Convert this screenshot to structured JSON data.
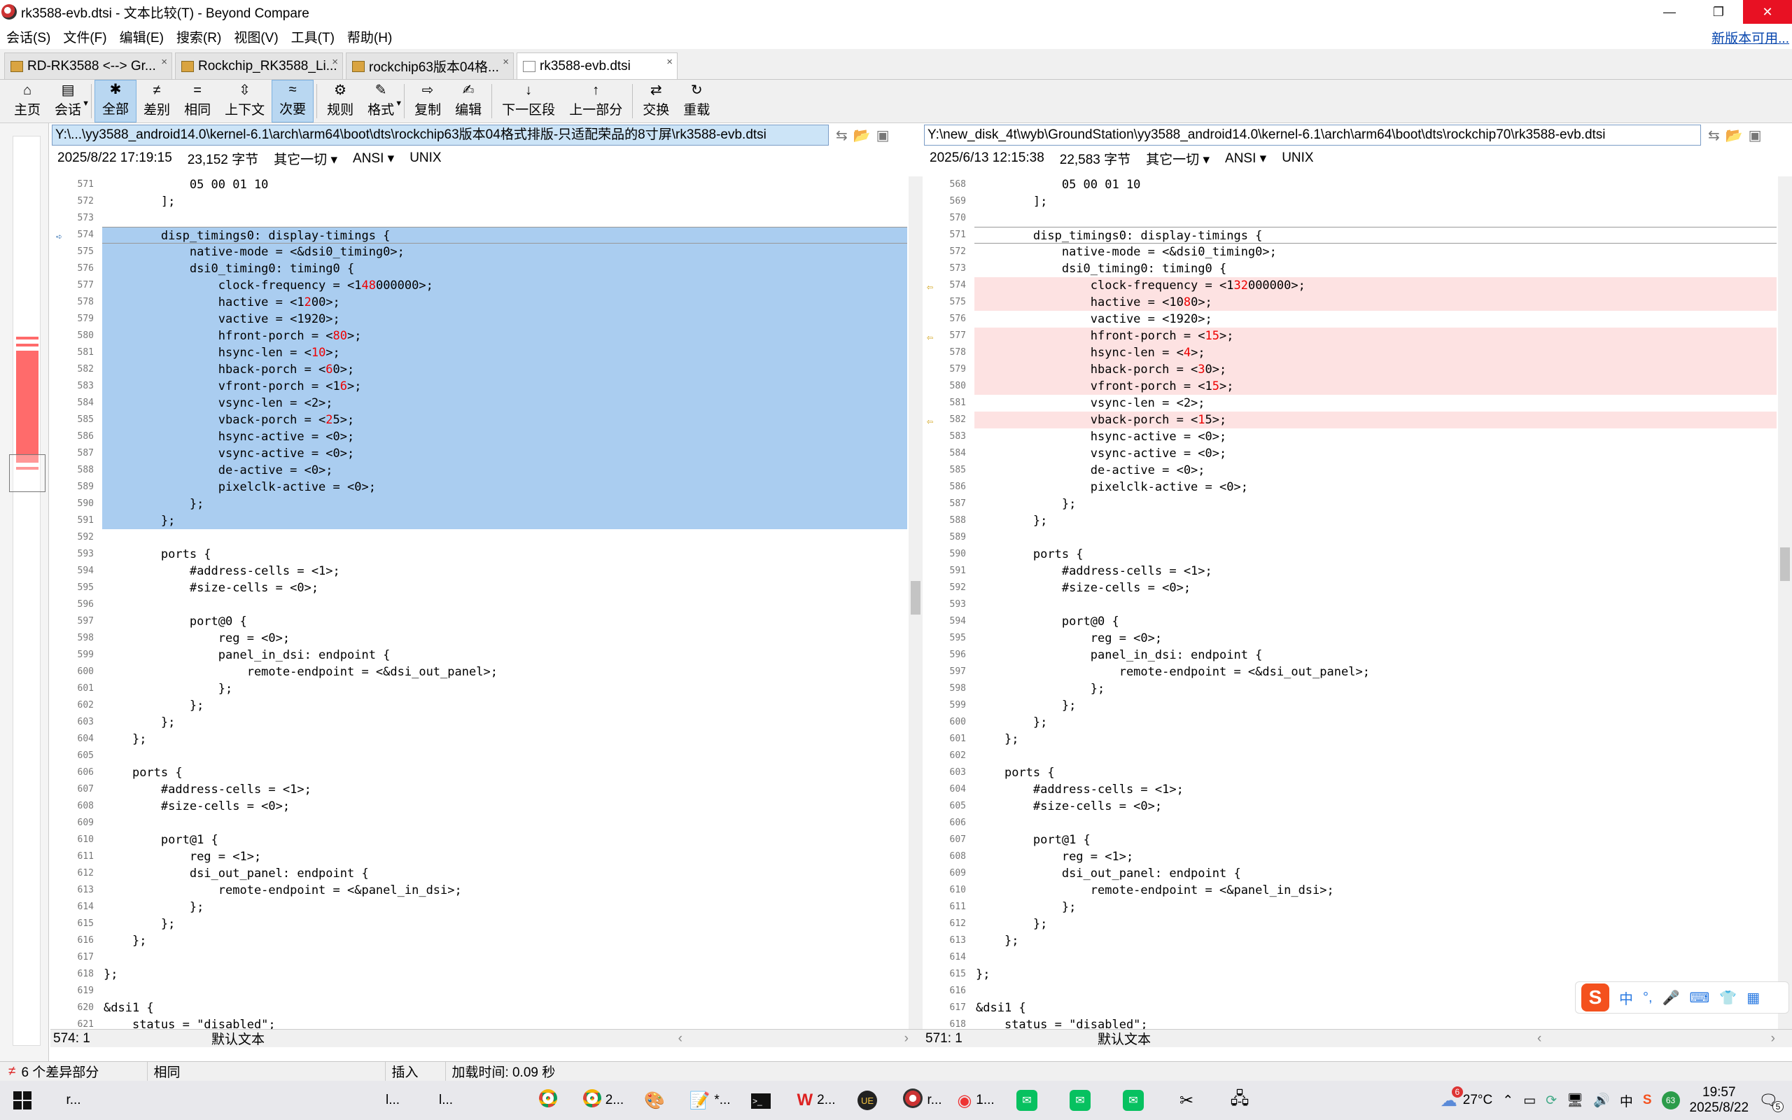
{
  "window": {
    "title": "rk3588-evb.dtsi - 文本比较(T) - Beyond Compare",
    "minimize": "—",
    "maximize": "❐",
    "close": "✕"
  },
  "menu": {
    "items": [
      "会话(S)",
      "文件(F)",
      "编辑(E)",
      "搜索(R)",
      "视图(V)",
      "工具(T)",
      "帮助(H)"
    ],
    "update_link": "新版本可用..."
  },
  "tabs": [
    {
      "label": "RD-RK3588 <--> Gr...",
      "close": "×"
    },
    {
      "label": "Rockchip_RK3588_Li...",
      "close": "×"
    },
    {
      "label": "rockchip63版本04格...",
      "close": "×"
    },
    {
      "label": "rk3588-evb.dtsi",
      "close": "×"
    }
  ],
  "toolbar": [
    {
      "icon": "⌂",
      "label": "主页",
      "name": "home-button"
    },
    {
      "icon": "▤",
      "label": "会话",
      "name": "session-button",
      "drop": true
    },
    {
      "icon": "✱",
      "label": "全部",
      "name": "show-all-button",
      "pressed": true
    },
    {
      "icon": "≠",
      "label": "差别",
      "name": "show-diffs-button"
    },
    {
      "icon": "=",
      "label": "相同",
      "name": "show-same-button"
    },
    {
      "icon": "⇳",
      "label": "上下文",
      "name": "context-button"
    },
    {
      "icon": "≈",
      "label": "次要",
      "name": "minor-button",
      "pressed": true
    },
    {
      "icon": "⚙",
      "label": "规则",
      "name": "rules-button"
    },
    {
      "icon": "✎",
      "label": "格式",
      "name": "format-button",
      "drop": true
    },
    {
      "icon": "⇨",
      "label": "复制",
      "name": "copy-button"
    },
    {
      "icon": "✍",
      "label": "编辑",
      "name": "edit-button"
    },
    {
      "icon": "↓",
      "label": "下一区段",
      "name": "next-section-button"
    },
    {
      "icon": "↑",
      "label": "上一部分",
      "name": "prev-section-button"
    },
    {
      "icon": "⇄",
      "label": "交换",
      "name": "swap-button"
    },
    {
      "icon": "↻",
      "label": "重载",
      "name": "reload-button"
    }
  ],
  "left": {
    "path": "Y:\\...\\yy3588_android14.0\\kernel-6.1\\arch\\arm64\\boot\\dts\\rockchip63版本04格式排版-只适配荣品的8寸屏\\rk3588-evb.dtsi",
    "date": "2025/8/22 17:19:15",
    "size": "23,152 字节",
    "other": "其它一切",
    "encoding": "ANSI",
    "eol": "UNIX",
    "position": "574: 1",
    "format": "默认文本",
    "lines": [
      {
        "n": "571",
        "t": "\t\t\t05 00 01 10"
      },
      {
        "n": "572",
        "t": "\t\t];"
      },
      {
        "n": "573",
        "t": ""
      },
      {
        "n": "574",
        "t": "\t\tdisp_timings0: display-timings {",
        "s": "sel",
        "cur": true,
        "a": "blue"
      },
      {
        "n": "575",
        "t": "\t\t\tnative-mode = <&dsi0_timing0>;",
        "s": "sel"
      },
      {
        "n": "576",
        "t": "\t\t\tdsi0_timing0: timing0 {",
        "s": "sel"
      },
      {
        "n": "577",
        "p": [
          "\t\t\t\tclock-frequency = <1",
          "48",
          "000000>;"
        ],
        "s": "sel"
      },
      {
        "n": "578",
        "p": [
          "\t\t\t\thactive = <1",
          "2",
          "00>;"
        ],
        "s": "sel"
      },
      {
        "n": "579",
        "t": "\t\t\t\tvactive = <1920>;",
        "s": "sel"
      },
      {
        "n": "580",
        "p": [
          "\t\t\t\thfront-porch = <",
          "80",
          ">;"
        ],
        "s": "sel"
      },
      {
        "n": "581",
        "p": [
          "\t\t\t\thsync-len = <",
          "10",
          ">;"
        ],
        "s": "sel"
      },
      {
        "n": "582",
        "p": [
          "\t\t\t\thback-porch = <",
          "6",
          "0>;"
        ],
        "s": "sel"
      },
      {
        "n": "583",
        "p": [
          "\t\t\t\tvfront-porch = <1",
          "6",
          ">;"
        ],
        "s": "sel"
      },
      {
        "n": "584",
        "t": "\t\t\t\tvsync-len = <2>;",
        "s": "sel"
      },
      {
        "n": "585",
        "p": [
          "\t\t\t\tvback-porch = <",
          "2",
          "5>;"
        ],
        "s": "sel"
      },
      {
        "n": "586",
        "t": "\t\t\t\thsync-active = <0>;",
        "s": "sel"
      },
      {
        "n": "587",
        "t": "\t\t\t\tvsync-active = <0>;",
        "s": "sel"
      },
      {
        "n": "588",
        "t": "\t\t\t\tde-active = <0>;",
        "s": "sel"
      },
      {
        "n": "589",
        "t": "\t\t\t\tpixelclk-active = <0>;",
        "s": "sel"
      },
      {
        "n": "590",
        "t": "\t\t\t};",
        "s": "sel"
      },
      {
        "n": "591",
        "t": "\t\t};",
        "s": "sel"
      },
      {
        "n": "592",
        "t": ""
      },
      {
        "n": "593",
        "t": "\t\tports {"
      },
      {
        "n": "594",
        "t": "\t\t\t#address-cells = <1>;"
      },
      {
        "n": "595",
        "t": "\t\t\t#size-cells = <0>;"
      },
      {
        "n": "596",
        "t": ""
      },
      {
        "n": "597",
        "t": "\t\t\tport@0 {"
      },
      {
        "n": "598",
        "t": "\t\t\t\treg = <0>;"
      },
      {
        "n": "599",
        "t": "\t\t\t\tpanel_in_dsi: endpoint {"
      },
      {
        "n": "600",
        "t": "\t\t\t\t\tremote-endpoint = <&dsi_out_panel>;"
      },
      {
        "n": "601",
        "t": "\t\t\t\t};"
      },
      {
        "n": "602",
        "t": "\t\t\t};"
      },
      {
        "n": "603",
        "t": "\t\t};"
      },
      {
        "n": "604",
        "t": "\t};"
      },
      {
        "n": "605",
        "t": ""
      },
      {
        "n": "606",
        "t": "\tports {"
      },
      {
        "n": "607",
        "t": "\t\t#address-cells = <1>;"
      },
      {
        "n": "608",
        "t": "\t\t#size-cells = <0>;"
      },
      {
        "n": "609",
        "t": ""
      },
      {
        "n": "610",
        "t": "\t\tport@1 {"
      },
      {
        "n": "611",
        "t": "\t\t\treg = <1>;"
      },
      {
        "n": "612",
        "t": "\t\t\tdsi_out_panel: endpoint {"
      },
      {
        "n": "613",
        "t": "\t\t\t\tremote-endpoint = <&panel_in_dsi>;"
      },
      {
        "n": "614",
        "t": "\t\t\t};"
      },
      {
        "n": "615",
        "t": "\t\t};"
      },
      {
        "n": "616",
        "t": "\t};"
      },
      {
        "n": "617",
        "t": ""
      },
      {
        "n": "618",
        "t": "};"
      },
      {
        "n": "619",
        "t": ""
      },
      {
        "n": "620",
        "t": "&dsi1 {"
      },
      {
        "n": "621",
        "t": "\tstatus = \"disabled\";"
      }
    ]
  },
  "right": {
    "path": "Y:\\new_disk_4t\\wyb\\GroundStation\\yy3588_android14.0\\kernel-6.1\\arch\\arm64\\boot\\dts\\rockchip70\\rk3588-evb.dtsi",
    "date": "2025/6/13 12:15:38",
    "size": "22,583 字节",
    "other": "其它一切",
    "encoding": "ANSI",
    "eol": "UNIX",
    "position": "571: 1",
    "format": "默认文本",
    "lines": [
      {
        "n": "568",
        "t": "\t\t\t05 00 01 10"
      },
      {
        "n": "569",
        "t": "\t\t];"
      },
      {
        "n": "570",
        "t": ""
      },
      {
        "n": "571",
        "t": "\t\tdisp_timings0: display-timings {",
        "cur": true
      },
      {
        "n": "572",
        "t": "\t\t\tnative-mode = <&dsi0_timing0>;"
      },
      {
        "n": "573",
        "t": "\t\t\tdsi0_timing0: timing0 {"
      },
      {
        "n": "574",
        "p": [
          "\t\t\t\tclock-frequency = <1",
          "32",
          "000000>;"
        ],
        "s": "diff",
        "a": "arrow"
      },
      {
        "n": "575",
        "p": [
          "\t\t\t\thactive = <10",
          "8",
          "0>;"
        ],
        "s": "diff"
      },
      {
        "n": "576",
        "t": "\t\t\t\tvactive = <1920>;"
      },
      {
        "n": "577",
        "p": [
          "\t\t\t\thfront-porch = <",
          "15",
          ">;"
        ],
        "s": "diff",
        "a": "arrow"
      },
      {
        "n": "578",
        "p": [
          "\t\t\t\thsync-len = <",
          "4",
          ">;"
        ],
        "s": "diff"
      },
      {
        "n": "579",
        "p": [
          "\t\t\t\thback-porch = <",
          "3",
          "0>;"
        ],
        "s": "diff"
      },
      {
        "n": "580",
        "p": [
          "\t\t\t\tvfront-porch = <1",
          "5",
          ">;"
        ],
        "s": "diff"
      },
      {
        "n": "581",
        "t": "\t\t\t\tvsync-len = <2>;"
      },
      {
        "n": "582",
        "p": [
          "\t\t\t\tvback-porch = <",
          "1",
          "5>;"
        ],
        "s": "diff",
        "a": "arrow"
      },
      {
        "n": "583",
        "t": "\t\t\t\thsync-active = <0>;"
      },
      {
        "n": "584",
        "t": "\t\t\t\tvsync-active = <0>;"
      },
      {
        "n": "585",
        "t": "\t\t\t\tde-active = <0>;"
      },
      {
        "n": "586",
        "t": "\t\t\t\tpixelclk-active = <0>;"
      },
      {
        "n": "587",
        "t": "\t\t\t};"
      },
      {
        "n": "588",
        "t": "\t\t};"
      },
      {
        "n": "589",
        "t": ""
      },
      {
        "n": "590",
        "t": "\t\tports {"
      },
      {
        "n": "591",
        "t": "\t\t\t#address-cells = <1>;"
      },
      {
        "n": "592",
        "t": "\t\t\t#size-cells = <0>;"
      },
      {
        "n": "593",
        "t": ""
      },
      {
        "n": "594",
        "t": "\t\t\tport@0 {"
      },
      {
        "n": "595",
        "t": "\t\t\t\treg = <0>;"
      },
      {
        "n": "596",
        "t": "\t\t\t\tpanel_in_dsi: endpoint {"
      },
      {
        "n": "597",
        "t": "\t\t\t\t\tremote-endpoint = <&dsi_out_panel>;"
      },
      {
        "n": "598",
        "t": "\t\t\t\t};"
      },
      {
        "n": "599",
        "t": "\t\t\t};"
      },
      {
        "n": "600",
        "t": "\t\t};"
      },
      {
        "n": "601",
        "t": "\t};"
      },
      {
        "n": "602",
        "t": ""
      },
      {
        "n": "603",
        "t": "\tports {"
      },
      {
        "n": "604",
        "t": "\t\t#address-cells = <1>;"
      },
      {
        "n": "605",
        "t": "\t\t#size-cells = <0>;"
      },
      {
        "n": "606",
        "t": ""
      },
      {
        "n": "607",
        "t": "\t\tport@1 {"
      },
      {
        "n": "608",
        "t": "\t\t\treg = <1>;"
      },
      {
        "n": "609",
        "t": "\t\t\tdsi_out_panel: endpoint {"
      },
      {
        "n": "610",
        "t": "\t\t\t\tremote-endpoint = <&panel_in_dsi>;"
      },
      {
        "n": "611",
        "t": "\t\t\t};"
      },
      {
        "n": "612",
        "t": "\t\t};"
      },
      {
        "n": "613",
        "t": "\t};"
      },
      {
        "n": "614",
        "t": ""
      },
      {
        "n": "615",
        "t": "};"
      },
      {
        "n": "616",
        "t": ""
      },
      {
        "n": "617",
        "t": "&dsi1 {"
      },
      {
        "n": "618",
        "t": "\tstatus = \"disabled\";"
      }
    ]
  },
  "status": {
    "diffs": "6 个差异部分",
    "same": "相同",
    "mode": "插入",
    "load": "加载时间: 0.09 秒"
  },
  "taskbar": {
    "items": [
      {
        "icon": "folder",
        "label": "r..."
      },
      {
        "icon": "folder",
        "label": ""
      },
      {
        "icon": "folder",
        "label": ""
      },
      {
        "icon": "folder",
        "label": ""
      },
      {
        "icon": "folder",
        "label": ""
      },
      {
        "icon": "folder",
        "label": ""
      },
      {
        "icon": "folder",
        "label": "l..."
      },
      {
        "icon": "folder",
        "label": "l..."
      },
      {
        "icon": "folder",
        "label": ""
      },
      {
        "icon": "chrome",
        "label": ""
      },
      {
        "icon": "chrome",
        "label": "2..."
      },
      {
        "icon": "paint",
        "label": ""
      },
      {
        "icon": "notepad",
        "label": "*..."
      },
      {
        "icon": "terminal",
        "label": ""
      },
      {
        "icon": "wps",
        "label": "2..."
      },
      {
        "icon": "ue",
        "label": ""
      },
      {
        "icon": "bc",
        "label": "r..."
      },
      {
        "icon": "app",
        "label": "1..."
      },
      {
        "icon": "wechat",
        "label": ""
      },
      {
        "icon": "wechat",
        "label": ""
      },
      {
        "icon": "wechat",
        "label": ""
      },
      {
        "icon": "tools",
        "label": ""
      },
      {
        "icon": "network",
        "label": ""
      }
    ],
    "weather": "27°C",
    "weather_badge": "6",
    "time": "19:57",
    "date": "2025/8/22",
    "notif": "5",
    "tray_ime": "中",
    "tray_sogou": "S",
    "tray_badge": "63"
  },
  "ime": {
    "mode": "中",
    "punct": "°,",
    "voice": "🎤",
    "keyboard": "⌨",
    "skin": "👕",
    "tools": "▦"
  }
}
